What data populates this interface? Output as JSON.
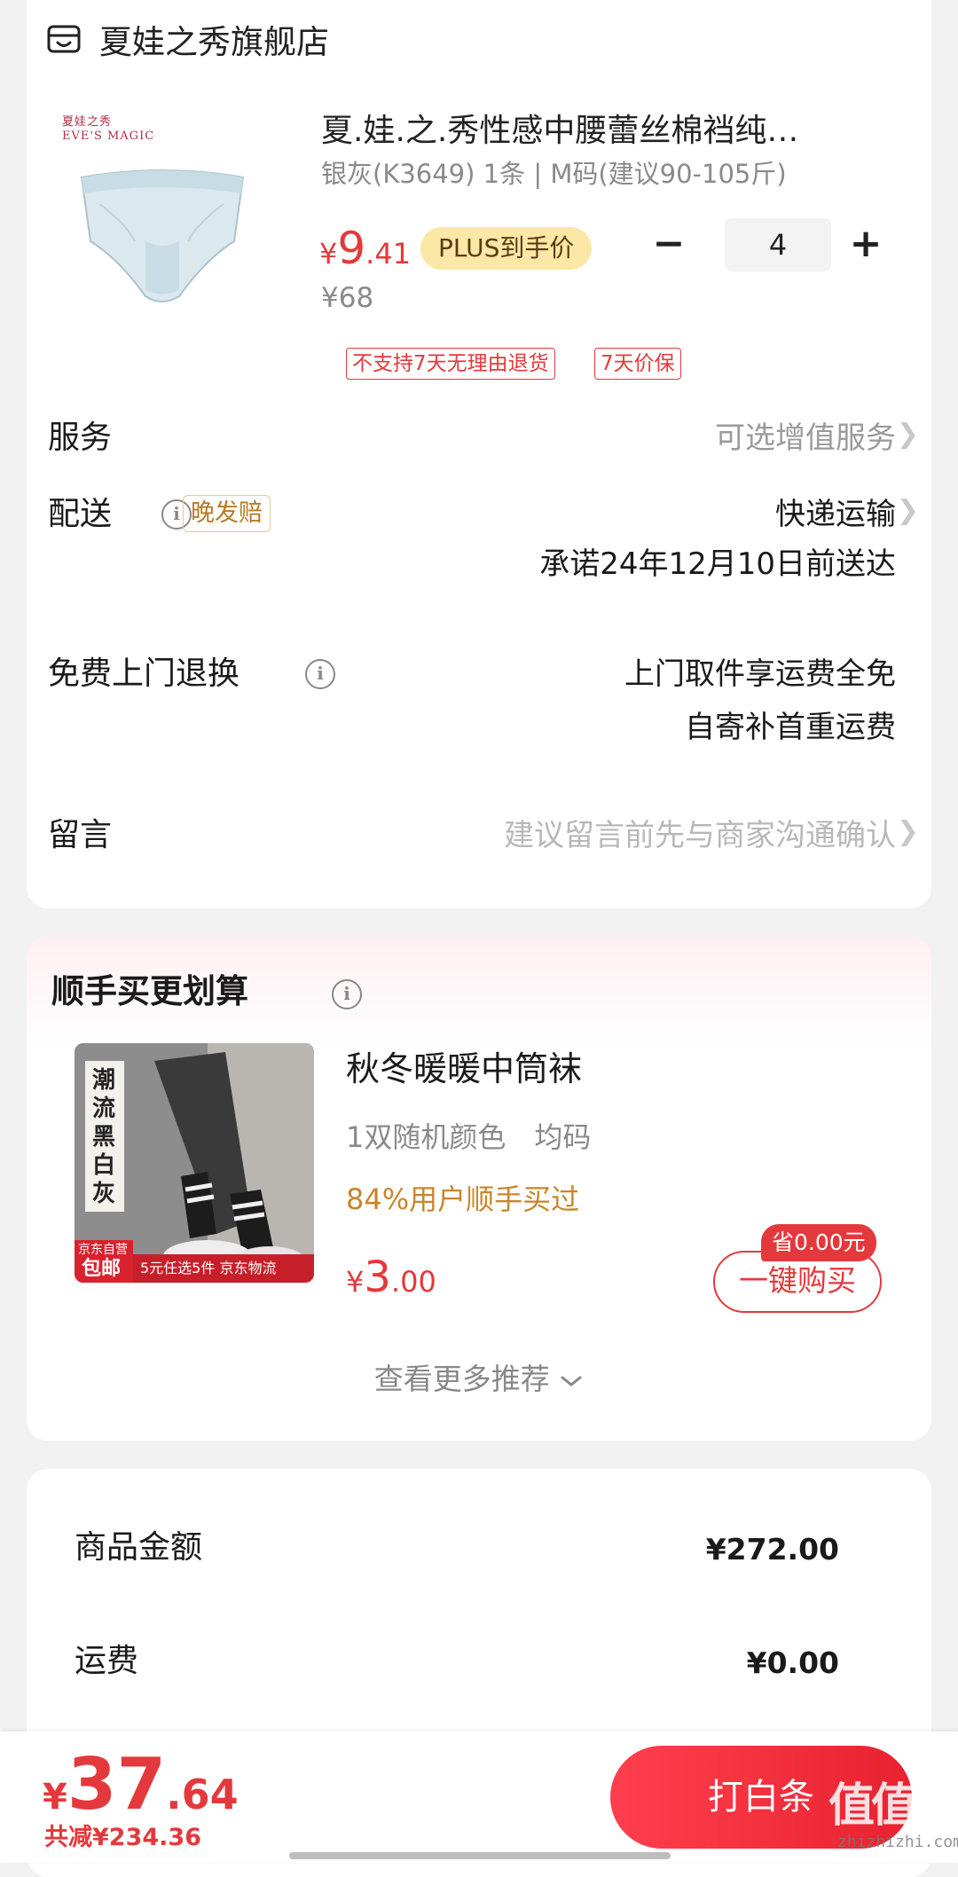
{
  "store": {
    "name": "夏娃之秀旗舰店",
    "icon": "store-icon"
  },
  "product": {
    "brand_logo": [
      "夏娃之秀",
      "EVE'S MAGIC"
    ],
    "title": "夏.娃.之.秀性感中腰蕾丝棉裆纯…",
    "spec": "银灰(K3649) 1条 | M码(建议90-105斤)",
    "price_currency": "¥",
    "price_int": "9",
    "price_dec": ".41",
    "plus_label": "PLUS到手价",
    "original_price": "¥68",
    "quantity": "4",
    "minus_label": "−",
    "plus_btn_label": "+",
    "tags": [
      "不支持7天无理由退货",
      "7天价保"
    ]
  },
  "service": {
    "label": "服务",
    "value": "可选增值服务"
  },
  "delivery": {
    "label": "配送",
    "badge": "晚发赔",
    "method": "快递运输",
    "promise": "承诺24年12月10日前送达"
  },
  "return_service": {
    "label": "免费上门退换",
    "line1": "上门取件享运费全免",
    "line2": "自寄补首重运费"
  },
  "message": {
    "label": "留言",
    "placeholder": "建议留言前先与商家沟通确认"
  },
  "recommend": {
    "title": "顺手买更划算",
    "item": {
      "image_text": {
        "vertical": "潮流黑白灰",
        "badge_top": "京东自营",
        "badge_bottom": "包邮",
        "promo": "5元任选5件 京东物流"
      },
      "name": "秋冬暖暖中筒袜",
      "spec": "1双随机颜色　均码",
      "social": "84%用户顺手买过",
      "price_currency": "¥",
      "price_int": "3",
      "price_dec": ".00",
      "save_badge": "省0.00元",
      "buy_label": "一键购买"
    },
    "more_label": "查看更多推荐"
  },
  "summary": {
    "rows": [
      {
        "label": "商品金额",
        "value": "¥272.00"
      },
      {
        "label": "运费",
        "value": "¥0.00"
      }
    ]
  },
  "checkout": {
    "total_currency": "¥",
    "total_int": "37",
    "total_dec": ".64",
    "discount": "共减¥234.36",
    "pay_label": "打白条",
    "watermark": "值值值",
    "watermark_url": "zhizhizhi.com"
  },
  "colors": {
    "accent": "#e4393c",
    "plus_badge": "#fbe7a6",
    "social_text": "#c9852c"
  }
}
